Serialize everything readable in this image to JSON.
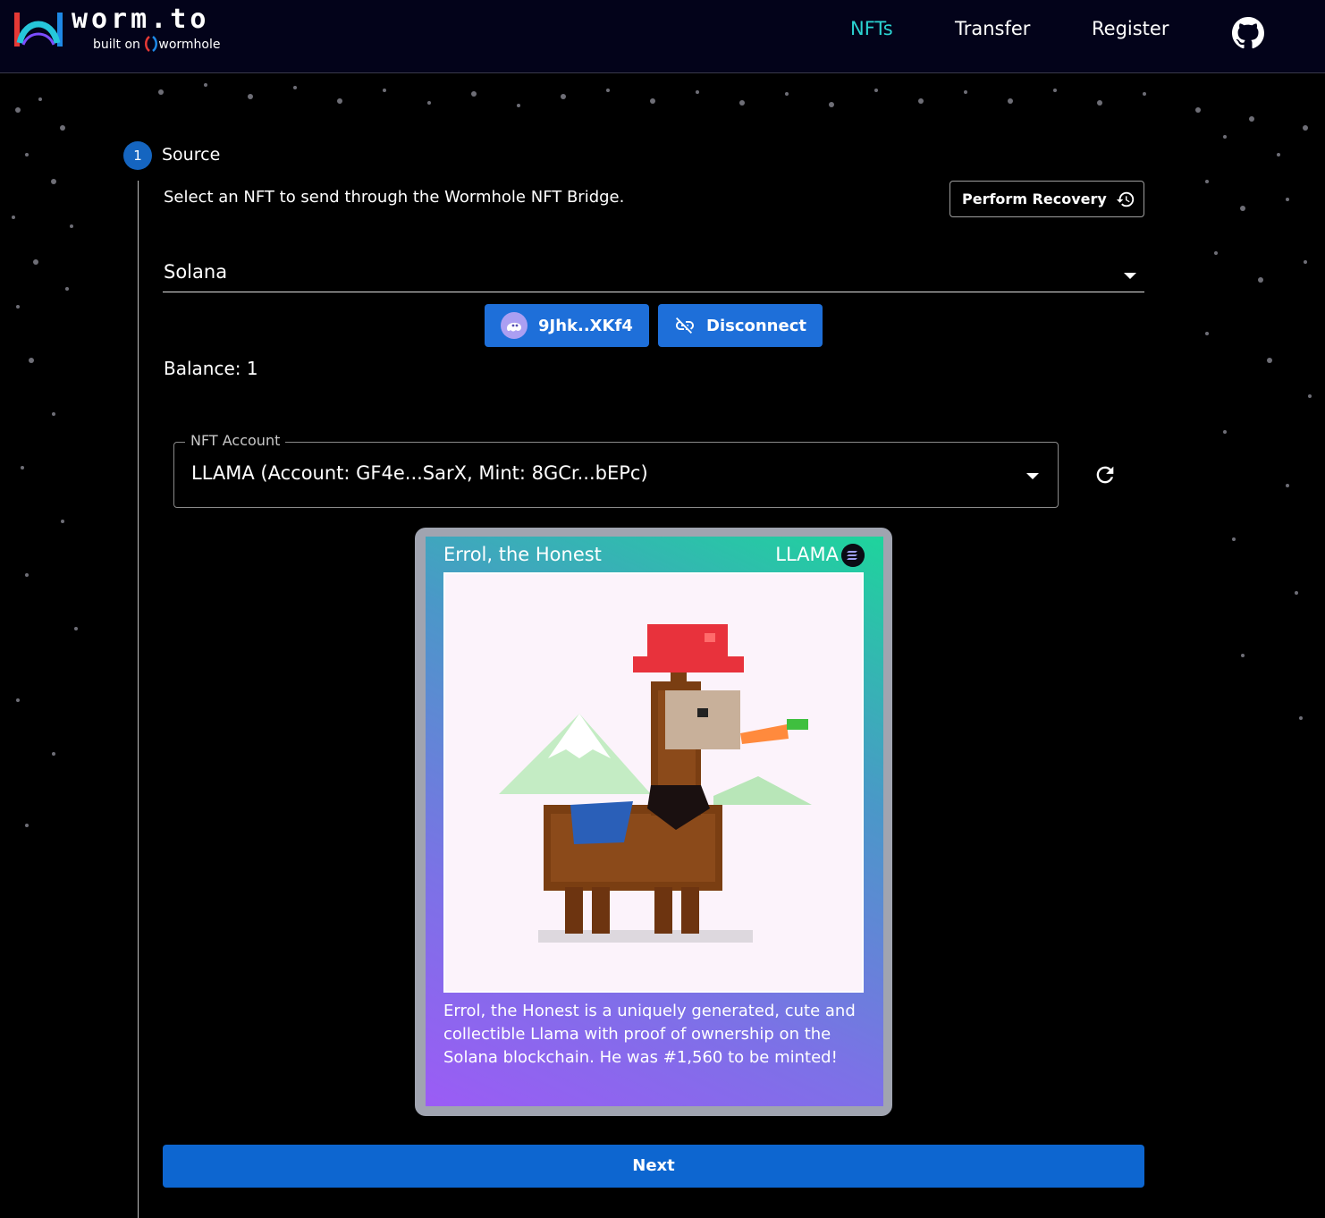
{
  "header": {
    "logo_text": "worm.to",
    "logo_sub_prefix": "built on",
    "logo_sub_brand": "wormhole",
    "nav": {
      "nfts": "NFTs",
      "transfer": "Transfer",
      "register": "Register"
    },
    "active_color": "#2bd4d2"
  },
  "stepper": {
    "step_number": "1",
    "step_label": "Source"
  },
  "source": {
    "description": "Select an NFT to send through the Wormhole NFT Bridge.",
    "recovery_label": "Perform Recovery",
    "chain": "Solana",
    "wallet_address": "9Jhk..XKf4",
    "disconnect_label": "Disconnect",
    "balance": "Balance: 1",
    "nft_account_label": "NFT Account",
    "nft_account_value": "LLAMA (Account: GF4e...SarX, Mint: 8GCr...bEPc)"
  },
  "nft_card": {
    "title": "Errol, the Honest",
    "symbol": "LLAMA",
    "description": "Errol, the Honest is a uniquely generated, cute and collectible Llama with proof of ownership on the Solana blockchain. He was #1,560 to be minted!"
  },
  "actions": {
    "next_label": "Next"
  },
  "colors": {
    "primary_button": "#1e6fd9",
    "next_button": "#0d66d0",
    "header_bg": "#03031a"
  }
}
